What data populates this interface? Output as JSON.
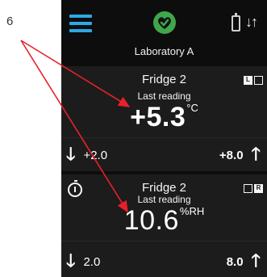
{
  "callout": {
    "label": "6"
  },
  "status_bar": {
    "location": "Laboratory A",
    "icons": [
      "menu-icon",
      "heart-check-icon",
      "battery-icon",
      "sync-arrows-icon"
    ],
    "accent_color": "#2ea8e6",
    "status_color": "#3fa74a"
  },
  "cards": [
    {
      "name": "Fridge 2",
      "subtitle": "Last reading",
      "value": "+5.3",
      "unit": "°C",
      "low": "+2.0",
      "high": "+8.0",
      "badges": [
        "L",
        ""
      ]
    },
    {
      "name": "Fridge 2",
      "subtitle": "Last reading",
      "value": "10.6",
      "unit": "%RH",
      "low": "2.0",
      "high": "8.0",
      "badges": [
        "",
        "R"
      ]
    }
  ],
  "annotation_color": "#e8202a"
}
